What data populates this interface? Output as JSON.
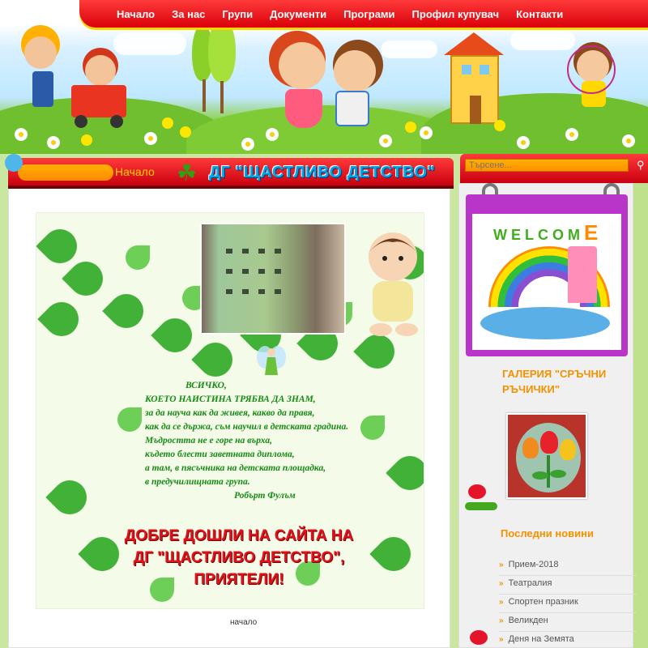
{
  "nav": {
    "items": [
      "Начало",
      "За нас",
      "Групи",
      "Документи",
      "Програми",
      "Профил купувач",
      "Контакти"
    ]
  },
  "page": {
    "breadcrumb": "Начало",
    "site_title": "ДГ \"ЩАСТЛИВО ДЕТСТВО\""
  },
  "banner": {
    "poem_lines": [
      "ВСИЧКО,",
      "КОЕТО НАИСТИНА ТРЯБВА ДА ЗНАМ,",
      "за да науча как да живея, какво да правя,",
      "как да се държа, съм научил в детската градина.",
      "Мъдростта не е горе на върха,",
      "където блести заветната диплома,",
      "а там, в пясъчника на детската площадка,",
      "в предучилищната група."
    ],
    "author": "Робърт Фулъм",
    "welcome_lines": [
      "ДОБРЕ ДОШЛИ НА САЙТА НА",
      "ДГ  \"ЩАСТЛИВО ДЕТСТВО\",",
      "ПРИЯТЕЛИ!"
    ],
    "caption": "начало"
  },
  "search": {
    "placeholder": "Търсене...",
    "icon": "search-icon"
  },
  "sidebar": {
    "welcome_letters": "WELCOM",
    "welcome_last": "E",
    "gallery_title": "ГАЛЕРИЯ \"СРЪЧНИ РЪЧИЧКИ\"",
    "news_title": "Последни новини",
    "news_bullet": "»",
    "news": [
      "Прием-2018",
      "Театралия",
      "Спортен празник",
      "Великден",
      "Деня на Земята"
    ]
  },
  "colors": {
    "nav_red": "#e0121b",
    "accent_orange": "#f29200",
    "poem_green": "#168a14",
    "title_blue": "#00a6e6"
  }
}
